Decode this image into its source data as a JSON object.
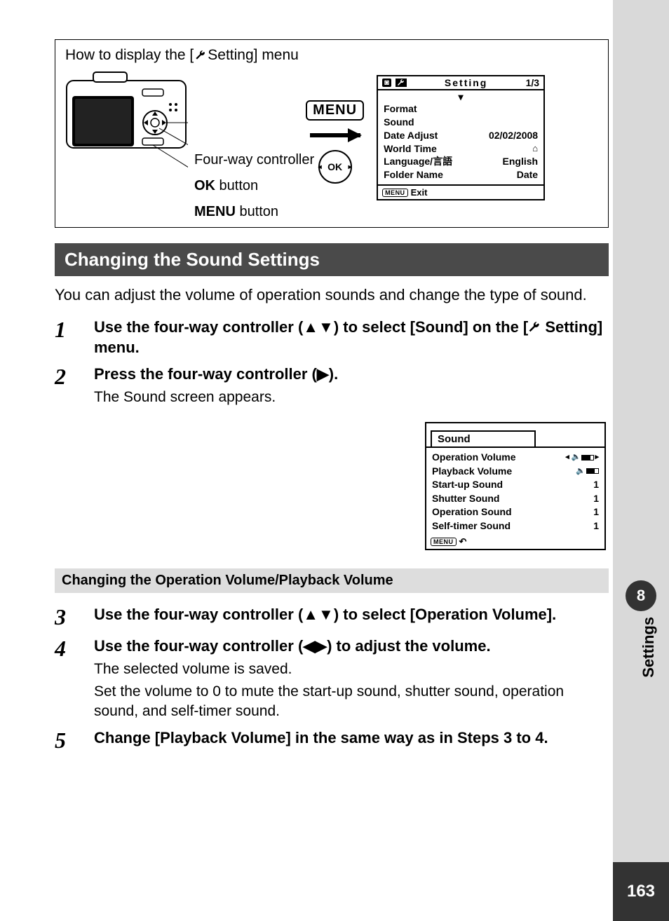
{
  "howto": {
    "title_pre": "How to display the [",
    "title_post": " Setting] menu",
    "labels": {
      "four_way": "Four-way controller",
      "ok_btn_pre": "OK",
      "ok_btn_post": "  button",
      "menu_btn_pre": "MENU",
      "menu_btn_post": " button"
    },
    "menu_badge": "MENU",
    "ok_round": "OK"
  },
  "lcd_setting": {
    "cam_icon": "▣",
    "wrench": "🔧",
    "title": "Setting",
    "page": "1/3",
    "rows": [
      {
        "l": "Format",
        "r": ""
      },
      {
        "l": "Sound",
        "r": ""
      },
      {
        "l": "Date Adjust",
        "r": "02/02/2008"
      },
      {
        "l": "World Time",
        "r": "⌂"
      },
      {
        "l": "Language/言語",
        "r": "English"
      },
      {
        "l": "Folder Name",
        "r": "Date"
      }
    ],
    "exit_badge": "MENU",
    "exit": "Exit"
  },
  "heading": "Changing the Sound Settings",
  "intro": "You can adjust the volume of operation sounds and change the type of sound.",
  "steps": {
    "s1": "Use the four-way controller (▲▼) to select [Sound] on the [🔧 Setting] menu.",
    "s2_bold": "Press the four-way controller (▶).",
    "s2_body": "The Sound screen appears."
  },
  "sound_lcd": {
    "tab": "Sound",
    "rows": [
      {
        "l": "Operation Volume",
        "r": "vol"
      },
      {
        "l": "Playback Volume",
        "r": "vol2"
      },
      {
        "l": "Start-up Sound",
        "r": "1"
      },
      {
        "l": "Shutter Sound",
        "r": "1"
      },
      {
        "l": "Operation Sound",
        "r": "1"
      },
      {
        "l": "Self-timer Sound",
        "r": "1"
      }
    ],
    "foot_badge": "MENU",
    "foot_icon": "↺"
  },
  "hbar2": "Changing the Operation Volume/Playback Volume",
  "steps2": {
    "s3": "Use the four-way controller (▲▼) to select [Operation Volume].",
    "s4_bold": "Use the four-way controller (◀▶) to adjust the volume.",
    "s4_b1": "The selected volume is saved.",
    "s4_b2": "Set the volume to 0 to mute the start-up sound, shutter sound, operation sound, and self-timer sound.",
    "s5": "Change [Playback Volume] in the same way as in Steps 3 to 4."
  },
  "side": {
    "chapter": "8",
    "tab": "Settings",
    "page": "163"
  }
}
